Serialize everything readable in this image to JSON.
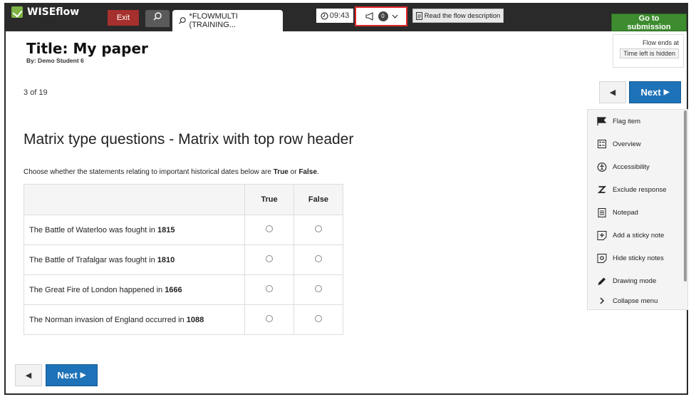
{
  "header": {
    "logo": "WISEflow",
    "exit_label": "Exit",
    "flow_tab_label": "*FLOWMULTI (TRAINING...",
    "timer": "09:43",
    "announcement_count": "0",
    "read_description_label": "Read the flow description",
    "submission_label": "Go to submission"
  },
  "paper": {
    "title": "Title: My paper",
    "byline": "By: Demo Student 6",
    "flow_ends_label": "Flow ends at",
    "time_left": "Time left is hidden"
  },
  "pager": {
    "position": "3 of 19",
    "next_label": "Next"
  },
  "question": {
    "heading": "Matrix type questions - Matrix with top row header",
    "instruction_pre": "Choose whether the statements relating to important historical dates below are ",
    "instruction_true": "True",
    "instruction_or": " or ",
    "instruction_false": "False",
    "instruction_end": ".",
    "columns": [
      "True",
      "False"
    ],
    "rows": [
      {
        "text": "The Battle of Waterloo was fought in ",
        "year": "1815"
      },
      {
        "text": "The Battle of Trafalgar was fought in ",
        "year": "1810"
      },
      {
        "text": "The Great Fire of London happened in ",
        "year": "1666"
      },
      {
        "text": "The Norman invasion of England occurred in ",
        "year": "1088"
      }
    ]
  },
  "menu": {
    "items": [
      {
        "label": "Flag item",
        "icon": "flag-icon"
      },
      {
        "label": "Overview",
        "icon": "overview-icon"
      },
      {
        "label": "Accessibility",
        "icon": "accessibility-icon"
      },
      {
        "label": "Exclude response",
        "icon": "exclude-icon"
      },
      {
        "label": "Notepad",
        "icon": "notepad-icon"
      },
      {
        "label": "Add a sticky note",
        "icon": "sticky-add-icon"
      },
      {
        "label": "Hide sticky notes",
        "icon": "sticky-hide-icon"
      },
      {
        "label": "Drawing mode",
        "icon": "pencil-icon"
      },
      {
        "label": "Collapse menu",
        "icon": "chevron-right-icon"
      }
    ]
  },
  "colors": {
    "topbar": "#2a2a2a",
    "exit": "#a5302d",
    "submission": "#3d8c2f",
    "next": "#1e73b8",
    "highlight": "#e0262b"
  }
}
